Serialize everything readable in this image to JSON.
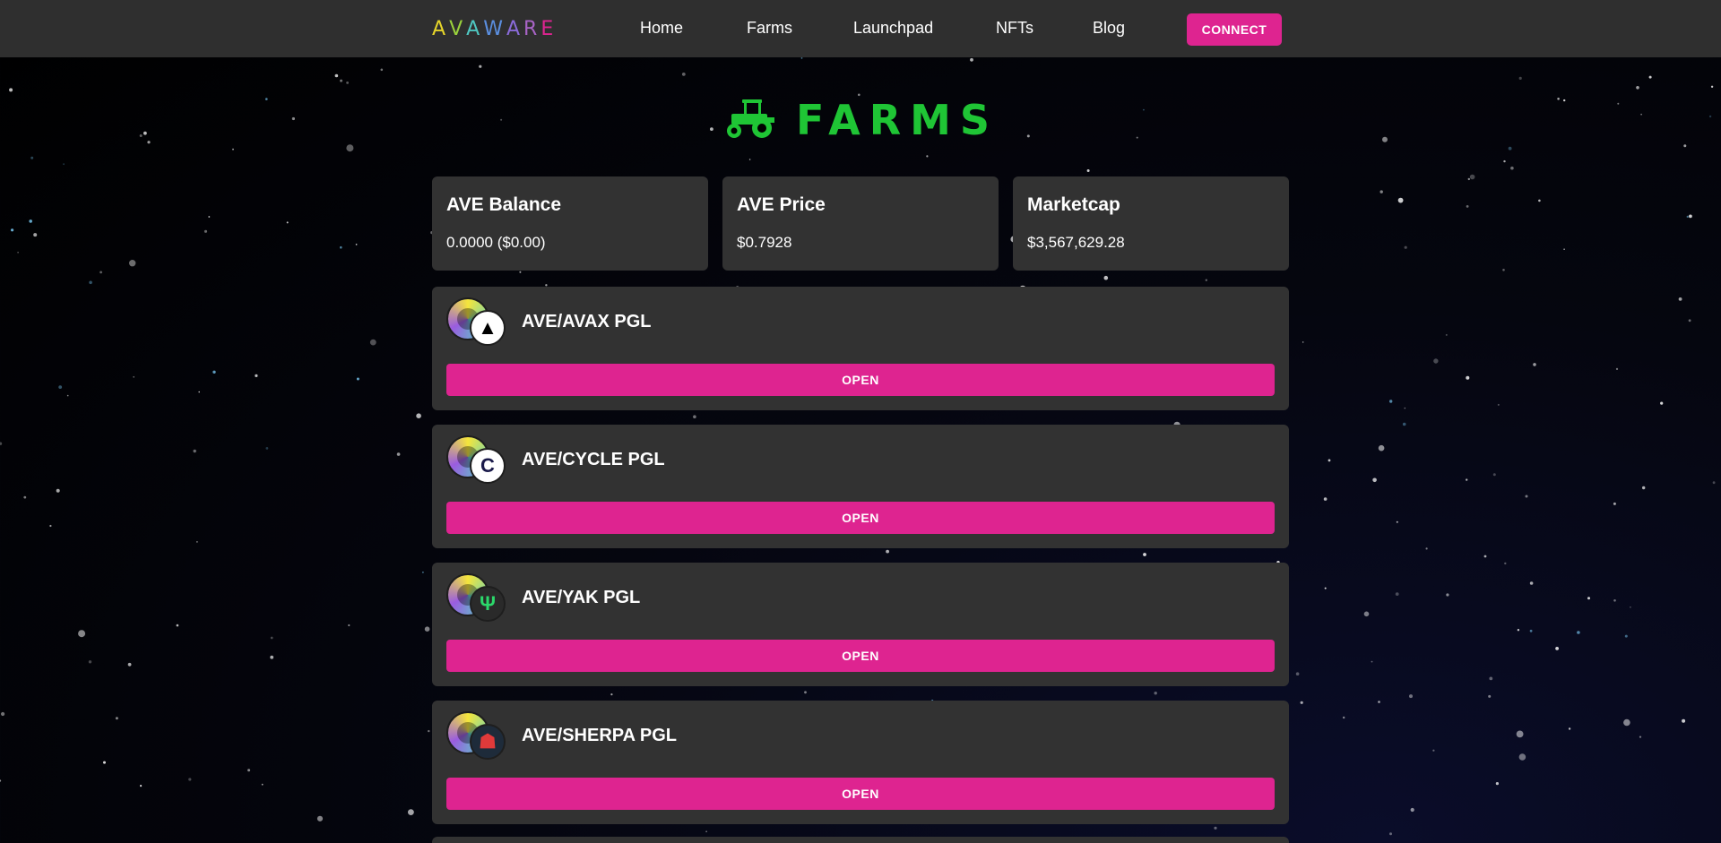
{
  "nav": {
    "logo_letters": [
      {
        "char": "A",
        "color": "#e6d52a"
      },
      {
        "char": "V",
        "color": "#9ad23c"
      },
      {
        "char": "A",
        "color": "#4fc7c1"
      },
      {
        "char": "W",
        "color": "#5b8fe0"
      },
      {
        "char": "A",
        "color": "#8a6bd9"
      },
      {
        "char": "R",
        "color": "#a864c6"
      },
      {
        "char": "E",
        "color": "#de2490"
      }
    ],
    "links": [
      "Home",
      "Farms",
      "Launchpad",
      "NFTs",
      "Blog"
    ],
    "connect_label": "CONNECT"
  },
  "page": {
    "title": "FARMS",
    "title_icon": "tractor-icon"
  },
  "stats": [
    {
      "label": "AVE Balance",
      "value": "0.0000 ($0.00)"
    },
    {
      "label": "AVE Price",
      "value": "$0.7928"
    },
    {
      "label": "Marketcap",
      "value": "$3,567,629.28"
    }
  ],
  "farms": [
    {
      "name": "AVE/AVAX PGL",
      "button": "OPEN",
      "token_icon": "avax-icon",
      "token_bg": "#ffffff",
      "token_fg": "#000000",
      "token_glyph": "▲"
    },
    {
      "name": "AVE/CYCLE PGL",
      "button": "OPEN",
      "token_icon": "cycle-icon",
      "token_bg": "#ffffff",
      "token_fg": "#1a1a4a",
      "token_glyph": "C"
    },
    {
      "name": "AVE/YAK PGL",
      "button": "OPEN",
      "token_icon": "yak-icon",
      "token_bg": "#2a2a2a",
      "token_fg": "#2bd96b",
      "token_glyph": "Ψ"
    },
    {
      "name": "AVE/SHERPA PGL",
      "button": "OPEN",
      "token_icon": "sherpa-icon",
      "token_bg": "#1e2b3a",
      "token_fg": "#e03a3a",
      "token_glyph": "☗"
    }
  ],
  "colors": {
    "accent": "#de2490",
    "title_green": "#1fc535",
    "card_bg": "#323232",
    "nav_bg": "#2f2f2f"
  }
}
